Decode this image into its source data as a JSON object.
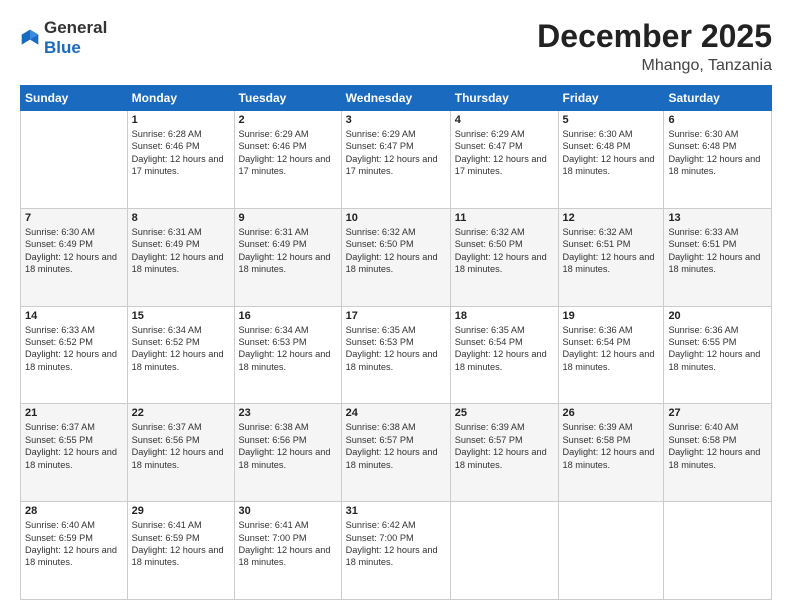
{
  "logo": {
    "general": "General",
    "blue": "Blue"
  },
  "header": {
    "month": "December 2025",
    "location": "Mhango, Tanzania"
  },
  "weekdays": [
    "Sunday",
    "Monday",
    "Tuesday",
    "Wednesday",
    "Thursday",
    "Friday",
    "Saturday"
  ],
  "weeks": [
    [
      {
        "day": "",
        "sunrise": "",
        "sunset": "",
        "daylight": ""
      },
      {
        "day": "1",
        "sunrise": "Sunrise: 6:28 AM",
        "sunset": "Sunset: 6:46 PM",
        "daylight": "Daylight: 12 hours and 17 minutes."
      },
      {
        "day": "2",
        "sunrise": "Sunrise: 6:29 AM",
        "sunset": "Sunset: 6:46 PM",
        "daylight": "Daylight: 12 hours and 17 minutes."
      },
      {
        "day": "3",
        "sunrise": "Sunrise: 6:29 AM",
        "sunset": "Sunset: 6:47 PM",
        "daylight": "Daylight: 12 hours and 17 minutes."
      },
      {
        "day": "4",
        "sunrise": "Sunrise: 6:29 AM",
        "sunset": "Sunset: 6:47 PM",
        "daylight": "Daylight: 12 hours and 17 minutes."
      },
      {
        "day": "5",
        "sunrise": "Sunrise: 6:30 AM",
        "sunset": "Sunset: 6:48 PM",
        "daylight": "Daylight: 12 hours and 18 minutes."
      },
      {
        "day": "6",
        "sunrise": "Sunrise: 6:30 AM",
        "sunset": "Sunset: 6:48 PM",
        "daylight": "Daylight: 12 hours and 18 minutes."
      }
    ],
    [
      {
        "day": "7",
        "sunrise": "Sunrise: 6:30 AM",
        "sunset": "Sunset: 6:49 PM",
        "daylight": "Daylight: 12 hours and 18 minutes."
      },
      {
        "day": "8",
        "sunrise": "Sunrise: 6:31 AM",
        "sunset": "Sunset: 6:49 PM",
        "daylight": "Daylight: 12 hours and 18 minutes."
      },
      {
        "day": "9",
        "sunrise": "Sunrise: 6:31 AM",
        "sunset": "Sunset: 6:49 PM",
        "daylight": "Daylight: 12 hours and 18 minutes."
      },
      {
        "day": "10",
        "sunrise": "Sunrise: 6:32 AM",
        "sunset": "Sunset: 6:50 PM",
        "daylight": "Daylight: 12 hours and 18 minutes."
      },
      {
        "day": "11",
        "sunrise": "Sunrise: 6:32 AM",
        "sunset": "Sunset: 6:50 PM",
        "daylight": "Daylight: 12 hours and 18 minutes."
      },
      {
        "day": "12",
        "sunrise": "Sunrise: 6:32 AM",
        "sunset": "Sunset: 6:51 PM",
        "daylight": "Daylight: 12 hours and 18 minutes."
      },
      {
        "day": "13",
        "sunrise": "Sunrise: 6:33 AM",
        "sunset": "Sunset: 6:51 PM",
        "daylight": "Daylight: 12 hours and 18 minutes."
      }
    ],
    [
      {
        "day": "14",
        "sunrise": "Sunrise: 6:33 AM",
        "sunset": "Sunset: 6:52 PM",
        "daylight": "Daylight: 12 hours and 18 minutes."
      },
      {
        "day": "15",
        "sunrise": "Sunrise: 6:34 AM",
        "sunset": "Sunset: 6:52 PM",
        "daylight": "Daylight: 12 hours and 18 minutes."
      },
      {
        "day": "16",
        "sunrise": "Sunrise: 6:34 AM",
        "sunset": "Sunset: 6:53 PM",
        "daylight": "Daylight: 12 hours and 18 minutes."
      },
      {
        "day": "17",
        "sunrise": "Sunrise: 6:35 AM",
        "sunset": "Sunset: 6:53 PM",
        "daylight": "Daylight: 12 hours and 18 minutes."
      },
      {
        "day": "18",
        "sunrise": "Sunrise: 6:35 AM",
        "sunset": "Sunset: 6:54 PM",
        "daylight": "Daylight: 12 hours and 18 minutes."
      },
      {
        "day": "19",
        "sunrise": "Sunrise: 6:36 AM",
        "sunset": "Sunset: 6:54 PM",
        "daylight": "Daylight: 12 hours and 18 minutes."
      },
      {
        "day": "20",
        "sunrise": "Sunrise: 6:36 AM",
        "sunset": "Sunset: 6:55 PM",
        "daylight": "Daylight: 12 hours and 18 minutes."
      }
    ],
    [
      {
        "day": "21",
        "sunrise": "Sunrise: 6:37 AM",
        "sunset": "Sunset: 6:55 PM",
        "daylight": "Daylight: 12 hours and 18 minutes."
      },
      {
        "day": "22",
        "sunrise": "Sunrise: 6:37 AM",
        "sunset": "Sunset: 6:56 PM",
        "daylight": "Daylight: 12 hours and 18 minutes."
      },
      {
        "day": "23",
        "sunrise": "Sunrise: 6:38 AM",
        "sunset": "Sunset: 6:56 PM",
        "daylight": "Daylight: 12 hours and 18 minutes."
      },
      {
        "day": "24",
        "sunrise": "Sunrise: 6:38 AM",
        "sunset": "Sunset: 6:57 PM",
        "daylight": "Daylight: 12 hours and 18 minutes."
      },
      {
        "day": "25",
        "sunrise": "Sunrise: 6:39 AM",
        "sunset": "Sunset: 6:57 PM",
        "daylight": "Daylight: 12 hours and 18 minutes."
      },
      {
        "day": "26",
        "sunrise": "Sunrise: 6:39 AM",
        "sunset": "Sunset: 6:58 PM",
        "daylight": "Daylight: 12 hours and 18 minutes."
      },
      {
        "day": "27",
        "sunrise": "Sunrise: 6:40 AM",
        "sunset": "Sunset: 6:58 PM",
        "daylight": "Daylight: 12 hours and 18 minutes."
      }
    ],
    [
      {
        "day": "28",
        "sunrise": "Sunrise: 6:40 AM",
        "sunset": "Sunset: 6:59 PM",
        "daylight": "Daylight: 12 hours and 18 minutes."
      },
      {
        "day": "29",
        "sunrise": "Sunrise: 6:41 AM",
        "sunset": "Sunset: 6:59 PM",
        "daylight": "Daylight: 12 hours and 18 minutes."
      },
      {
        "day": "30",
        "sunrise": "Sunrise: 6:41 AM",
        "sunset": "Sunset: 7:00 PM",
        "daylight": "Daylight: 12 hours and 18 minutes."
      },
      {
        "day": "31",
        "sunrise": "Sunrise: 6:42 AM",
        "sunset": "Sunset: 7:00 PM",
        "daylight": "Daylight: 12 hours and 18 minutes."
      },
      {
        "day": "",
        "sunrise": "",
        "sunset": "",
        "daylight": ""
      },
      {
        "day": "",
        "sunrise": "",
        "sunset": "",
        "daylight": ""
      },
      {
        "day": "",
        "sunrise": "",
        "sunset": "",
        "daylight": ""
      }
    ]
  ]
}
